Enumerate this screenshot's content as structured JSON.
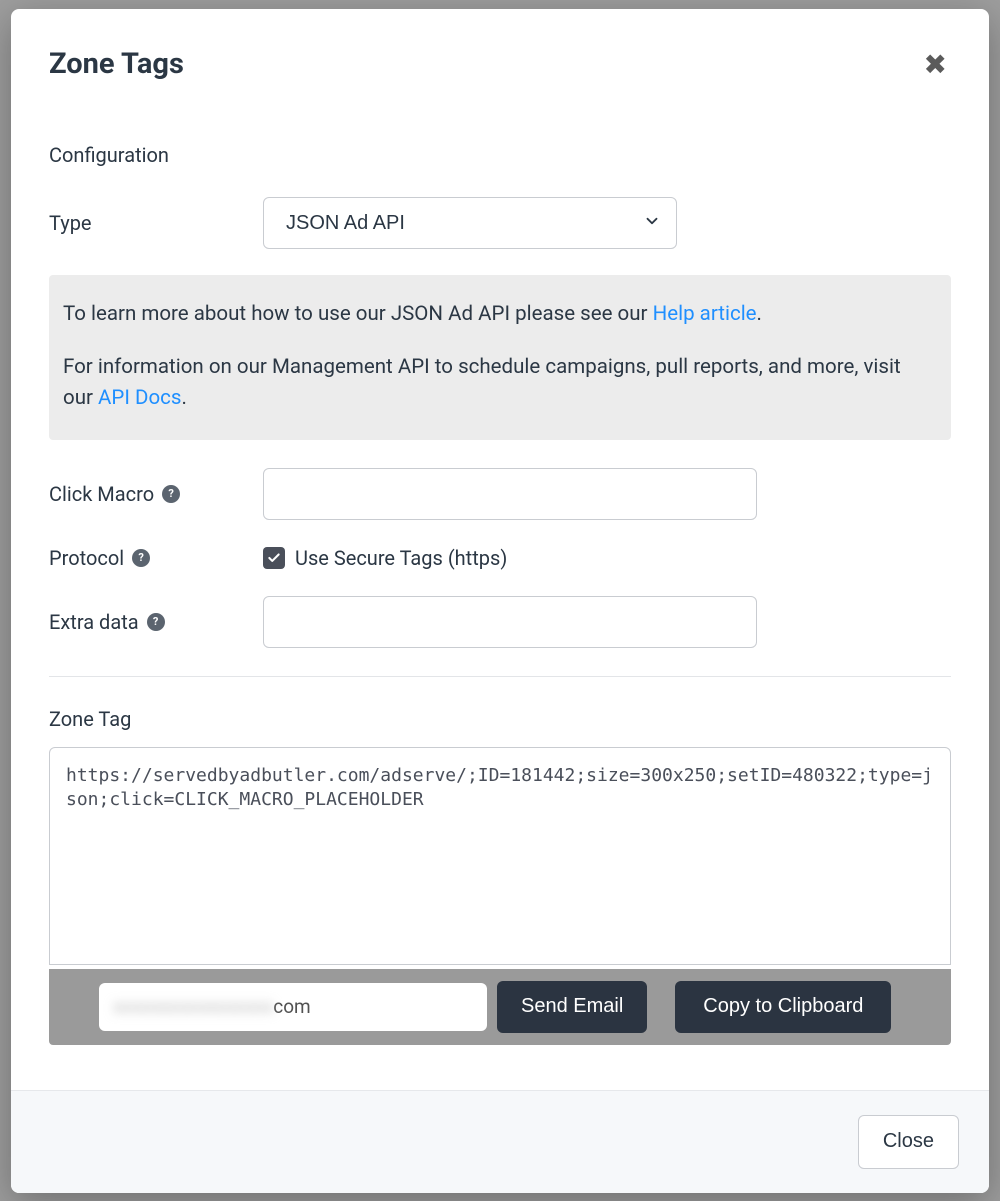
{
  "modal": {
    "title": "Zone Tags",
    "close_icon": "✖",
    "close_button": "Close"
  },
  "configuration": {
    "heading": "Configuration",
    "type_label": "Type",
    "type_value": "JSON Ad API",
    "info": {
      "line1_prefix": "To learn more about how to use our JSON Ad API please see our ",
      "line1_link": "Help article",
      "line1_suffix": ".",
      "line2_prefix": "For information on our Management API to schedule campaigns, pull reports, and more, visit our ",
      "line2_link": "API Docs",
      "line2_suffix": "."
    },
    "click_macro_label": "Click Macro",
    "click_macro_value": "",
    "protocol_label": "Protocol",
    "secure_checkbox_checked": true,
    "secure_checkbox_label": "Use Secure Tags (https)",
    "extra_data_label": "Extra data",
    "extra_data_value": "",
    "help_icon": "?"
  },
  "zone_tag": {
    "label": "Zone Tag",
    "code": "https://servedbyadbutler.com/adserve/;ID=181442;size=300x250;setID=480322;type=json;click=CLICK_MACRO_PLACEHOLDER"
  },
  "actions": {
    "email_suffix": "com",
    "send_email": "Send Email",
    "copy": "Copy to Clipboard"
  }
}
